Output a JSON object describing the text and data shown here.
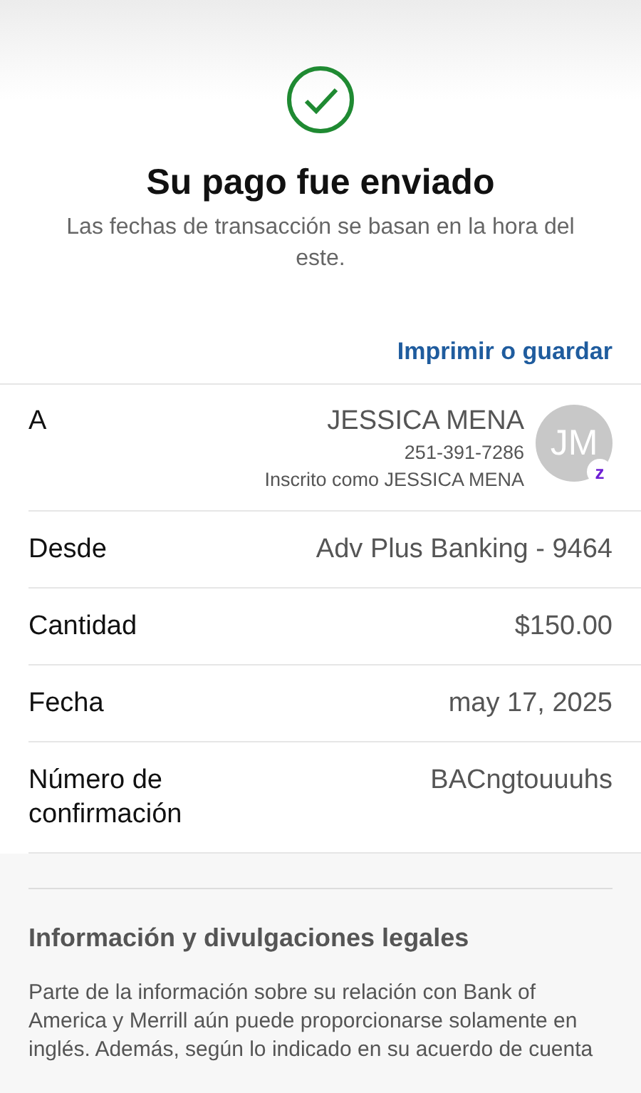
{
  "header": {
    "title": "Su pago fue enviado",
    "subtitle": "Las fechas de transacción se basan en la hora del este.",
    "print_link": "Imprimir o guardar"
  },
  "details": [
    {
      "kind": "recipient",
      "label": "A",
      "name": "JESSICA MENA",
      "phone": "251-391-7286",
      "enrolled": "Inscrito como JESSICA MENA",
      "initials": "JM",
      "badge": "z"
    },
    {
      "kind": "text",
      "label": "Desde",
      "value": "Adv Plus Banking - 9464"
    },
    {
      "kind": "text",
      "label": "Cantidad",
      "value": "$150.00"
    },
    {
      "kind": "text",
      "label": "Fecha",
      "value": "may 17, 2025"
    },
    {
      "kind": "text",
      "label": "Número de confirmación",
      "value": "BACngtouuuhs"
    }
  ],
  "legal": {
    "title": "Información y divulgaciones legales",
    "body": "Parte de la información sobre su relación con Bank of America y Merrill aún puede proporcionarse solamente en inglés. Además, según lo indicado en su acuerdo de cuenta"
  }
}
